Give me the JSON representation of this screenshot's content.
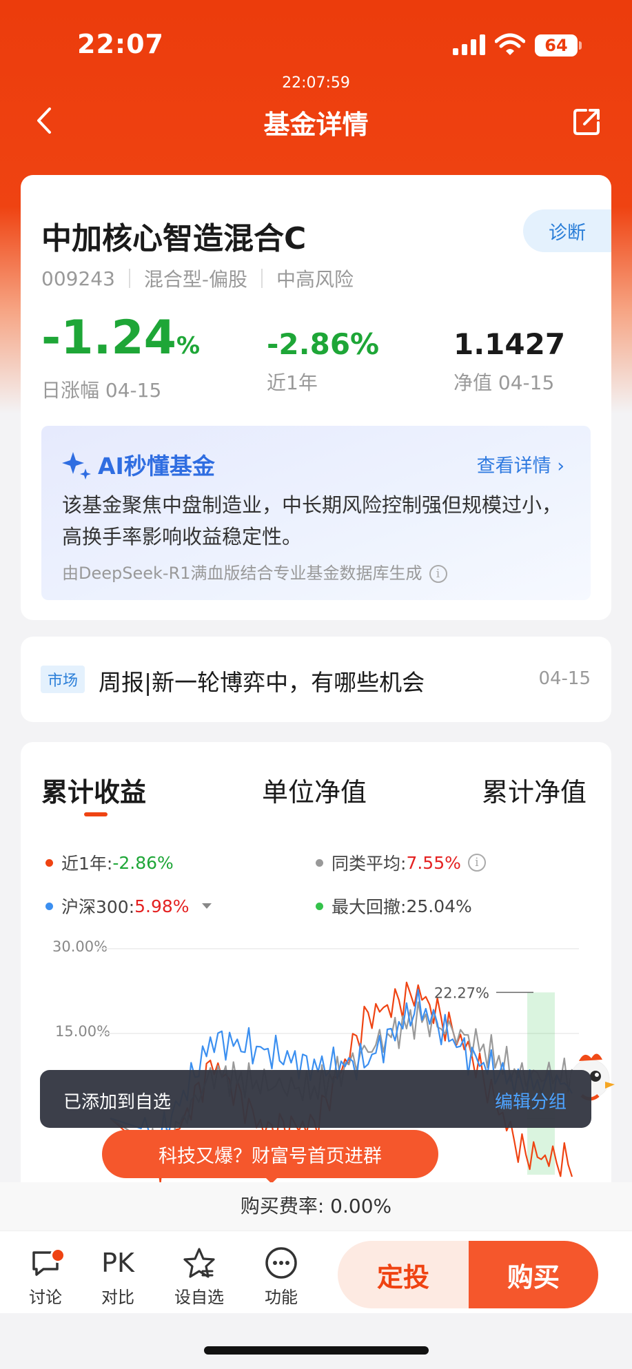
{
  "status_bar": {
    "time": "22:07",
    "battery": "64"
  },
  "header": {
    "clock": "22:07:59",
    "title": "基金详情"
  },
  "fund": {
    "name": "中加核心智造混合C",
    "diagnose_label": "诊断",
    "code": "009243",
    "type": "混合型-偏股",
    "risk": "中高风险",
    "daily_change_value": "-1.24",
    "daily_change_unit": "%",
    "daily_change_label": "日涨幅 04-15",
    "year_change_value": "-2.86%",
    "year_change_label": "近1年",
    "nav_value": "1.1427",
    "nav_label": "净值 04-15"
  },
  "ai_summary": {
    "title": "AI秒懂基金",
    "link": "查看详情",
    "text": "该基金聚焦中盘制造业，中长期风险控制强但规模过小，高换手率影响收益稳定性。",
    "footer": "由DeepSeek-R1满血版结合专业基金数据库生成"
  },
  "news": {
    "tag": "市场",
    "title": "周报|新一轮博弈中，有哪些机会",
    "date": "04-15"
  },
  "chart_tabs": [
    "累计收益",
    "单位净值",
    "累计净值"
  ],
  "legend": {
    "fund_label": "近1年:",
    "fund_value": "-2.86%",
    "avg_label": "同类平均:",
    "avg_value": "7.55%",
    "index_label": "沪深300:",
    "index_value": "5.98%",
    "drawdown_label": "最大回撤:",
    "drawdown_value": "25.04%"
  },
  "chart_data": {
    "type": "line",
    "y_ticks": [
      "30.00%",
      "15.00%"
    ],
    "ylim": [
      -10,
      30
    ],
    "peak_label": "22.27%",
    "series": [
      {
        "name": "近1年",
        "color": "#ef4312",
        "values": [
          0,
          -8,
          10,
          -2,
          -1,
          18,
          22.27,
          12,
          -6,
          -8
        ]
      },
      {
        "name": "同类平均",
        "color": "#999999",
        "values": [
          0,
          -6,
          8,
          6,
          5,
          12,
          18,
          14,
          7.55,
          7.55
        ]
      },
      {
        "name": "沪深300",
        "color": "#3b8ff0",
        "values": [
          0,
          -3,
          14,
          12,
          9,
          10,
          20,
          11,
          5.98,
          5.98
        ]
      }
    ]
  },
  "toast": {
    "message": "已添加到自选",
    "action": "编辑分组"
  },
  "promo": {
    "text": "科技又爆？财富号首页进群"
  },
  "fee": {
    "text": "购买费率: 0.00%"
  },
  "bottom_nav": {
    "discuss": "讨论",
    "compare_icon": "PK",
    "compare": "对比",
    "watch": "设自选",
    "more": "功能",
    "auto_invest": "定投",
    "buy": "购买"
  }
}
